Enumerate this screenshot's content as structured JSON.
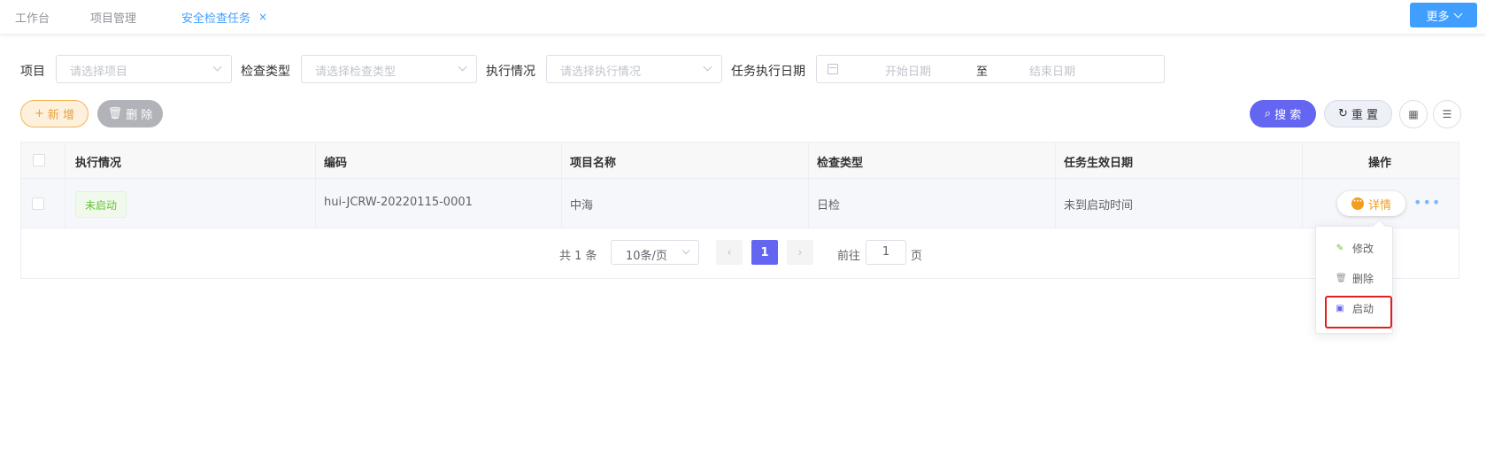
{
  "tabs": [
    {
      "label": "工作台",
      "active": false
    },
    {
      "label": "项目管理",
      "active": false
    },
    {
      "label": "安全检查任务",
      "active": true
    }
  ],
  "tab_close_glyph": "×",
  "more_button": "更多",
  "filters": {
    "project_label": "项目",
    "project_placeholder": "请选择项目",
    "check_type_label": "检查类型",
    "check_type_placeholder": "请选择检查类型",
    "exec_label": "执行情况",
    "exec_placeholder": "请选择执行情况",
    "date_label": "任务执行日期",
    "date_start": "开始日期",
    "date_sep": "至",
    "date_end": "结束日期"
  },
  "actions": {
    "add": "新 增",
    "delete": "删 除",
    "search": "搜 索",
    "reset": "重 置"
  },
  "table": {
    "headers": [
      "执行情况",
      "编码",
      "项目名称",
      "检查类型",
      "任务生效日期",
      "操作"
    ],
    "rows": [
      {
        "status": "未启动",
        "code": "hui-JCRW-20220115-0001",
        "project": "中海",
        "check_type": "日检",
        "effective_date": "未到启动时间",
        "detail": "详情"
      }
    ]
  },
  "pagination": {
    "total": "共 1 条",
    "page_size": "10条/页",
    "current_page": "1",
    "goto_label": "前往",
    "goto_value": "1",
    "page_suffix": "页"
  },
  "dropdown": {
    "items": [
      {
        "label": "修改",
        "icon": "edit-icon"
      },
      {
        "label": "删除",
        "icon": "trash-icon"
      },
      {
        "label": "启动",
        "icon": "start-icon"
      }
    ]
  },
  "colors": {
    "primary": "#409eff",
    "accent": "#6466f1",
    "warning": "#e6a23c",
    "success": "#67c23a",
    "highlight": "#e02020"
  }
}
